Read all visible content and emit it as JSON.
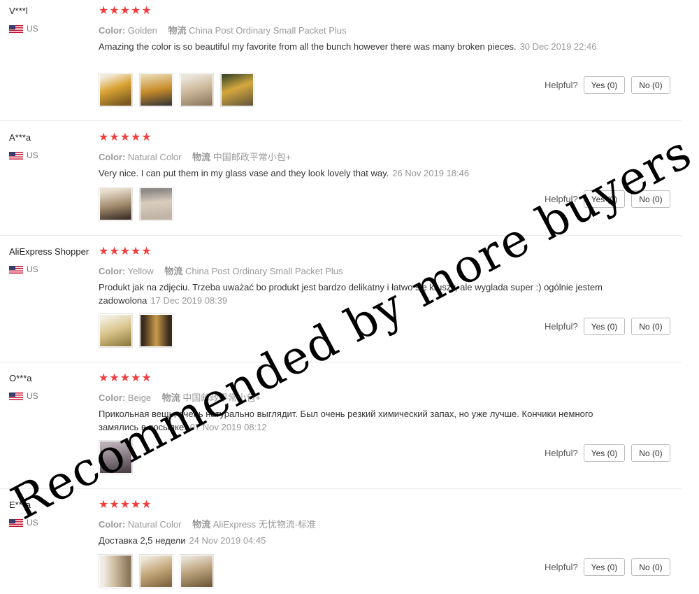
{
  "helpful_label": "Helpful?",
  "watermark": "Recommended by more buyers",
  "reviews": [
    {
      "user": "V***l",
      "country": "US",
      "stars": "★★★★★",
      "color_label": "Color:",
      "color": "Golden",
      "logistics_label": "物流",
      "logistics": "China Post Ordinary Small Packet Plus",
      "text": "Amazing the color is so beautiful my favorite from all the bunch however there was many broken pieces.",
      "date": "30 Dec 2019 22:46",
      "yes": "Yes (0)",
      "no": "No (0)",
      "thumbs": [
        "#d9a233",
        "#c98d2a",
        "#cbb79a",
        "#d4a83d"
      ]
    },
    {
      "user": "A***a",
      "country": "US",
      "stars": "★★★★★",
      "color_label": "Color:",
      "color": "Natural Color",
      "logistics_label": "物流",
      "logistics": "中国邮政平常小包+",
      "text": "Very nice. I can put them in my glass vase and they look lovely that way.",
      "date": "26 Nov 2019 18:46",
      "yes": "Yes (0)",
      "no": "No (0)",
      "thumbs": [
        "#a08a6c",
        "#bfb4a6"
      ]
    },
    {
      "user": "AliExpress Shopper",
      "country": "US",
      "stars": "★★★★★",
      "color_label": "Color:",
      "color": "Yellow",
      "logistics_label": "物流",
      "logistics": "China Post Ordinary Small Packet Plus",
      "text": "Produkt jak na zdjęciu. Trzeba uważać bo produkt jest bardzo delikatny i łatwo się kruszy, ale wyglada super :) ogólnie jestem zadowolona",
      "date": "17 Dec 2019 08:39",
      "yes": "Yes (0)",
      "no": "No (0)",
      "thumbs": [
        "#d8c48a",
        "#9a6a2a"
      ]
    },
    {
      "user": "O***a",
      "country": "US",
      "stars": "★★★★★",
      "color_label": "Color:",
      "color": "Beige",
      "logistics_label": "物流",
      "logistics": "中国邮政平常小包+",
      "text": "Прикольная вещь, очень натурально выглядит. Был очень резкий химический запах, но уже лучше. Кончики немного замялись в посылке.",
      "date": "07 Nov 2019 08:12",
      "yes": "Yes (0)",
      "no": "No (0)",
      "thumbs": [
        "#8a7e86"
      ]
    },
    {
      "user": "E***a",
      "country": "US",
      "stars": "★★★★★",
      "color_label": "Color:",
      "color": "Natural Color",
      "logistics_label": "物流",
      "logistics": "AliExpress 无忧物流-标准",
      "text": "Доставка 2,5 недели",
      "date": "24 Nov 2019 04:45",
      "yes": "Yes (0)",
      "no": "No (0)",
      "thumbs": [
        "#c9b79a",
        "#c4a77a",
        "#b9a07a"
      ]
    }
  ]
}
